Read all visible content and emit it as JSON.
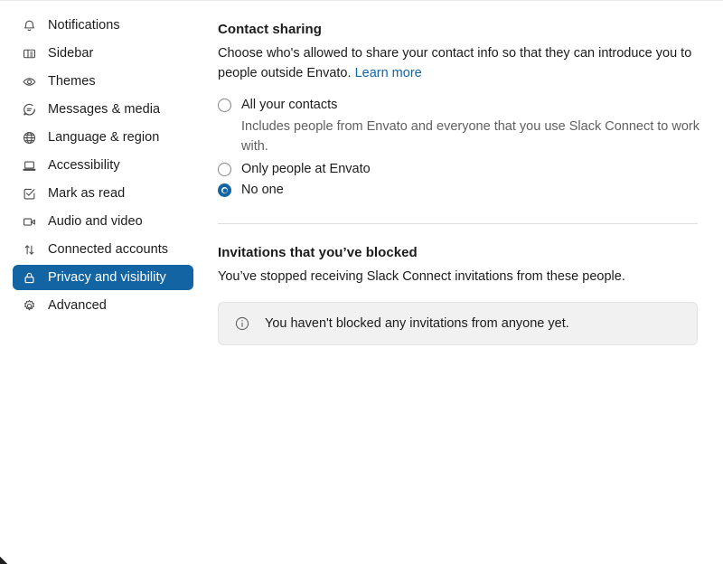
{
  "sidebar": {
    "items": [
      {
        "label": "Notifications",
        "icon": "bell-icon",
        "selected": false
      },
      {
        "label": "Sidebar",
        "icon": "sidebar-icon",
        "selected": false
      },
      {
        "label": "Themes",
        "icon": "eye-icon",
        "selected": false
      },
      {
        "label": "Messages & media",
        "icon": "message-bubble-icon",
        "selected": false
      },
      {
        "label": "Language & region",
        "icon": "globe-icon",
        "selected": false
      },
      {
        "label": "Accessibility",
        "icon": "laptop-icon",
        "selected": false
      },
      {
        "label": "Mark as read",
        "icon": "check-square-icon",
        "selected": false
      },
      {
        "label": "Audio and video",
        "icon": "video-camera-icon",
        "selected": false
      },
      {
        "label": "Connected accounts",
        "icon": "arrows-up-down-icon",
        "selected": false
      },
      {
        "label": "Privacy and visibility",
        "icon": "lock-icon",
        "selected": true
      },
      {
        "label": "Advanced",
        "icon": "gear-icon",
        "selected": false
      }
    ]
  },
  "main": {
    "contact_sharing": {
      "title": "Contact sharing",
      "description_before_link": "Choose who's allowed to share your contact info so that they can introduce you to people outside Envato. ",
      "link_label": "Learn more",
      "options": [
        {
          "label": "All your contacts",
          "help": "Includes people from Envato and everyone that you use Slack Connect to work with.",
          "selected": false
        },
        {
          "label": "Only people at Envato",
          "help": "",
          "selected": false
        },
        {
          "label": "No one",
          "help": "",
          "selected": true
        }
      ]
    },
    "blocked_invitations": {
      "title": "Invitations that you’ve blocked",
      "description": "You’ve stopped receiving Slack Connect invitations from these people.",
      "empty_state": {
        "icon": "info-circle-icon",
        "text": "You haven't blocked any invitations from anyone yet."
      }
    }
  },
  "colors": {
    "accent": "#1264a3",
    "link": "#1264a3",
    "text": "#1d1c1d",
    "muted_text": "#616061",
    "infobox_bg": "#f1f1f1",
    "divider": "#dddddd"
  }
}
